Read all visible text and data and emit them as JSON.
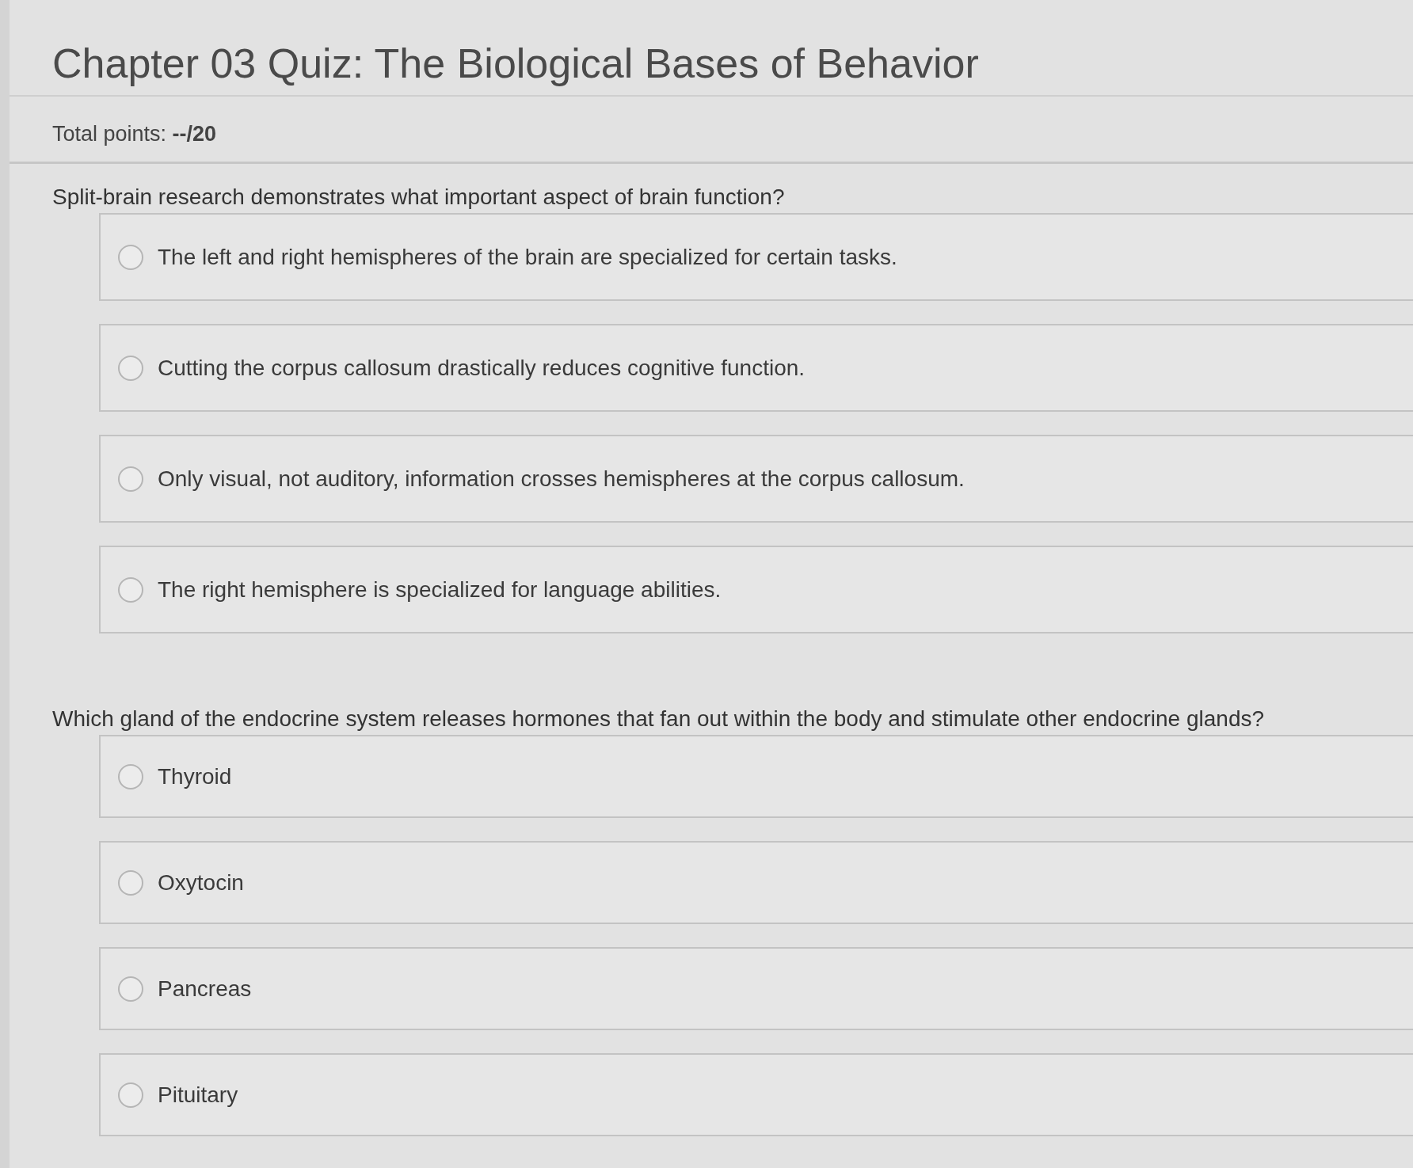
{
  "title": "Chapter 03 Quiz: The Biological Bases of Behavior",
  "total_points": "Total points: **--/20**",
  "questions": [
    {
      "prompt": "Split-brain research demonstrates what important aspect of brain function?",
      "options": [
        {
          "label": "The left and right hemispheres of the brain are specialized for certain tasks.",
          "selected": false
        },
        {
          "label": "Cutting the corpus callosum drastically reduces cognitive function.",
          "selected": false
        },
        {
          "label": "Only visual, not auditory, information crosses hemispheres at the corpus callosum.",
          "selected": false
        },
        {
          "label": "The right hemisphere is specialized for language abilities.",
          "selected": false
        }
      ]
    },
    {
      "prompt": "Which gland of the endocrine system releases hormones that fan out within the body and stimulate other endocrine glands?",
      "options": [
        {
          "label": "Thyroid",
          "selected": false
        },
        {
          "label": "Oxytocin",
          "selected": false
        },
        {
          "label": "Pancreas",
          "selected": false
        },
        {
          "label": "Pituitary",
          "selected": false
        }
      ]
    }
  ]
}
